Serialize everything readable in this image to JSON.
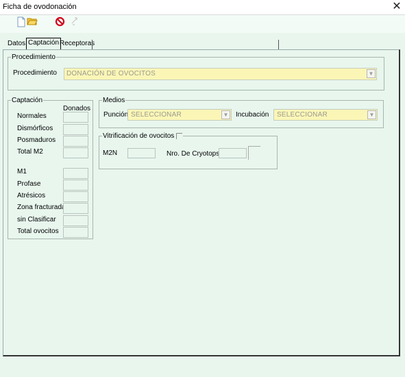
{
  "window": {
    "title": "Ficha de ovodonación",
    "close_glyph": "✕"
  },
  "toolbar": {
    "items": [
      {
        "icon": "new-document-icon",
        "glyph": "🗋"
      },
      {
        "icon": "open-folder-icon",
        "glyph": "📂"
      },
      {
        "icon": "cancel-icon",
        "glyph": "⊘"
      },
      {
        "icon": "disabled-tool-icon",
        "glyph": "⛶"
      }
    ]
  },
  "tabs": [
    {
      "label": "Datos",
      "active": false
    },
    {
      "label": "Captación",
      "active": true
    },
    {
      "label": "Receptoras",
      "active": false
    }
  ],
  "procedimiento": {
    "legend": "Procedimiento",
    "label": "Procedimiento",
    "value": "DONACIÓN DE OVOCITOS"
  },
  "captacion": {
    "legend": "Captación",
    "column_header": "Donados",
    "rows_top": [
      "Normales",
      "Dismórficos",
      "Posmaduros",
      "Total M2"
    ],
    "rows_bottom": [
      "M1",
      "Profase",
      "Atrésicos",
      "Zona fracturada",
      "sin Clasificar",
      "Total ovocitos"
    ]
  },
  "medios": {
    "legend": "Medios",
    "puncion_label": "Punción",
    "puncion_value": "SELECCIONAR",
    "incubacion_label": "Incubación",
    "incubacion_value": "SELECCIONAR"
  },
  "vitrificacion": {
    "legend": "Vitrificación de ovocitos",
    "m2n_label": "M2N",
    "cryotops_label": "Nro. De Cryotops"
  },
  "colors": {
    "panel": "#e8f6ee",
    "combo": "#fbf6b6",
    "cancel": "#d0021b",
    "folder": "#f0b400"
  }
}
